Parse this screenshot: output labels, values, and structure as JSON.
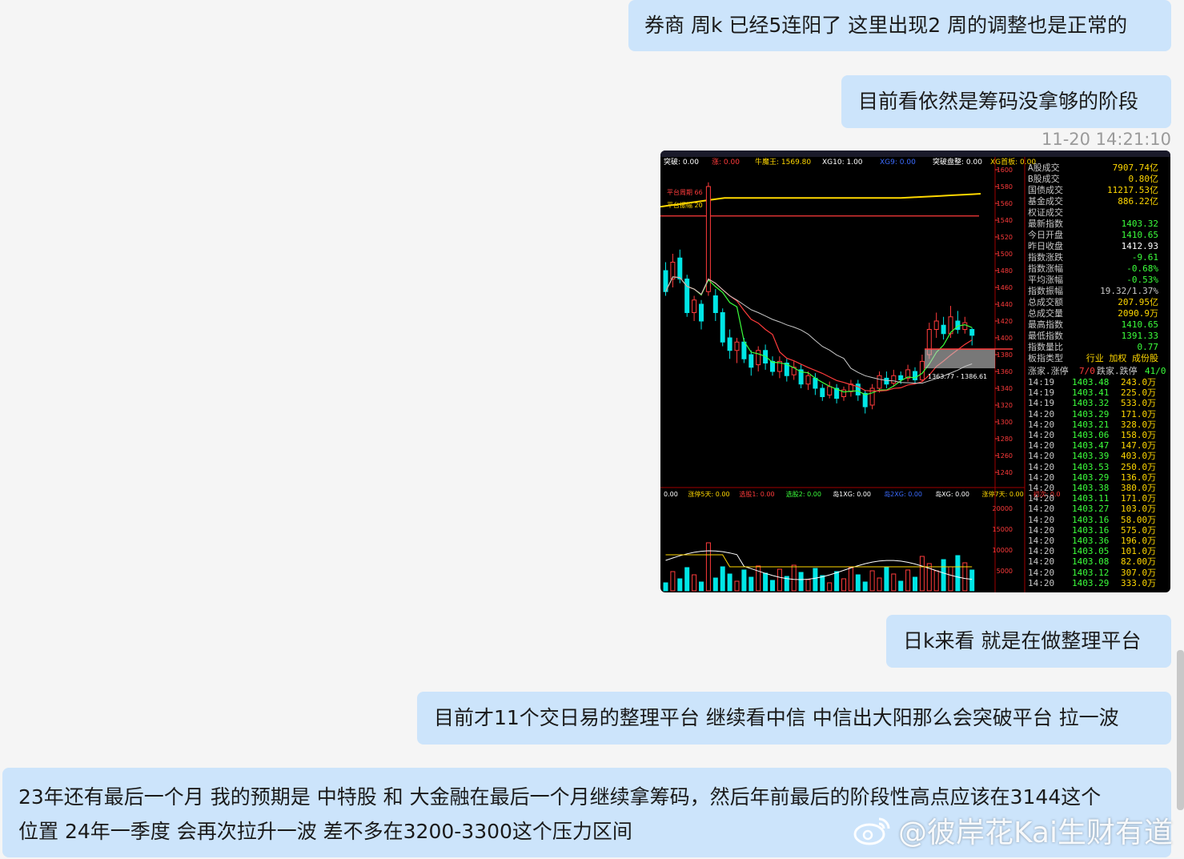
{
  "messages": [
    {
      "text": "券商 周k  已经5连阳了 这里出现2 周的调整也是正常的"
    },
    {
      "text": "目前看依然是筹码没拿够的阶段"
    },
    {
      "timestamp": "11-20 14:21:10"
    },
    {
      "text": "日k来看 就是在做整理平台"
    },
    {
      "text": "目前才11个交日易的整理平台  继续看中信 中信出大阳那么会突破平台 拉一波"
    },
    {
      "text_line1": "23年还有最后一个月 我的预期是 中特股 和 大金融在最后一个月继续拿筹码，然后年前最后的阶段性高点应该在3144这个",
      "text_line2": "位置 24年一季度 会再次拉升一波 差不多在3200-3300这个压力区间"
    }
  ],
  "watermark": "@彼岸花Kai生财有道",
  "screenshot": {
    "top_indicators": [
      {
        "text": "突破: 0.00",
        "color": "#ffffff"
      },
      {
        "text": "涨: 0.00",
        "color": "#ff3b3b"
      },
      {
        "text": "牛魔王: 1569.80",
        "color": "#ffd700"
      },
      {
        "text": "XG10: 1.00",
        "color": "#ffffff"
      },
      {
        "text": "XG9: 0.00",
        "color": "#3b6bff"
      },
      {
        "text": "突破盘整: 0.00",
        "color": "#ffffff"
      },
      {
        "text": "XG首板: 0.00",
        "color": "#ffd700"
      }
    ],
    "platform_labels": [
      "平台周期 66",
      "平台振幅 20"
    ],
    "range_label": "1363.77 - 1386.61",
    "price_axis": [
      "1600",
      "1580",
      "1560",
      "1540",
      "1520",
      "1500",
      "1480",
      "1460",
      "1440",
      "1420",
      "1400",
      "1380",
      "1360",
      "1340",
      "1320",
      "1300",
      "1280",
      "1260",
      "1240"
    ],
    "vol_axis": [
      "20000",
      "15000",
      "10000",
      "5000"
    ],
    "bottom_indicators": [
      {
        "text": "0.00",
        "color": "#ffffff"
      },
      {
        "text": "涨停5天: 0.00",
        "color": "#ffd700"
      },
      {
        "text": "选股1: 0.00",
        "color": "#ff3b3b"
      },
      {
        "text": "选股2: 0.00",
        "color": "#3bff3b"
      },
      {
        "text": "岛1XG: 0.00",
        "color": "#ffffff"
      },
      {
        "text": "岛2XG: 0.00",
        "color": "#3b6bff"
      },
      {
        "text": "岛XG: 0.00",
        "color": "#ffffff"
      },
      {
        "text": "涨停7天: 0.00",
        "color": "#ffd700"
      },
      {
        "text": "初次: 0.0",
        "color": "#ff3b3b"
      }
    ],
    "stats": [
      {
        "label": "A股成交",
        "value": "7907.74亿",
        "color": "#ffd700"
      },
      {
        "label": "B股成交",
        "value": "0.80亿",
        "color": "#ffd700"
      },
      {
        "label": "国债成交",
        "value": "11217.53亿",
        "color": "#ffd700"
      },
      {
        "label": "基金成交",
        "value": "886.22亿",
        "color": "#ffd700"
      },
      {
        "label": "权证成交",
        "value": "",
        "color": "#ffd700"
      },
      {
        "label": "最新指数",
        "value": "1403.32",
        "color": "#3bff3b"
      },
      {
        "label": "今日开盘",
        "value": "1410.65",
        "color": "#3bff3b"
      },
      {
        "label": "昨日收盘",
        "value": "1412.93",
        "color": "#ffffff"
      },
      {
        "label": "指数涨跌",
        "value": "-9.61",
        "color": "#3bff3b"
      },
      {
        "label": "指数涨幅",
        "value": "-0.68%",
        "color": "#3bff3b"
      },
      {
        "label": "平均涨幅",
        "value": "-0.53%",
        "color": "#3bff3b"
      },
      {
        "label": "指数振幅",
        "value": "19.32/1.37%",
        "color": "#c8c8c8"
      },
      {
        "label": "总成交额",
        "value": "207.95亿",
        "color": "#ffd700"
      },
      {
        "label": "总成交量",
        "value": "2090.9万",
        "color": "#ffd700"
      },
      {
        "label": "最高指数",
        "value": "1410.65",
        "color": "#3bff3b"
      },
      {
        "label": "最低指数",
        "value": "1391.33",
        "color": "#3bff3b"
      },
      {
        "label": "指数量比",
        "value": "0.77",
        "color": "#3bff3b"
      }
    ],
    "board_type": {
      "label": "板指类型",
      "value": "行业 加权 成份股"
    },
    "updown": {
      "label": "涨家.涨停",
      "value1": "7/0",
      "label2": "跌家.跌停",
      "value2": "41/0"
    },
    "ticks": [
      {
        "time": "14:19",
        "price": "1403.48",
        "vol": "243.0万"
      },
      {
        "time": "14:19",
        "price": "1403.41",
        "vol": "225.0万"
      },
      {
        "time": "14:19",
        "price": "1403.32",
        "vol": "533.0万"
      },
      {
        "time": "14:20",
        "price": "1403.29",
        "vol": "171.0万"
      },
      {
        "time": "14:20",
        "price": "1403.21",
        "vol": "328.0万"
      },
      {
        "time": "14:20",
        "price": "1403.06",
        "vol": "158.0万"
      },
      {
        "time": "14:20",
        "price": "1403.47",
        "vol": "147.0万"
      },
      {
        "time": "14:20",
        "price": "1403.39",
        "vol": "403.0万"
      },
      {
        "time": "14:20",
        "price": "1403.53",
        "vol": "250.0万"
      },
      {
        "time": "14:20",
        "price": "1403.29",
        "vol": "136.0万"
      },
      {
        "time": "14:20",
        "price": "1403.38",
        "vol": "380.0万"
      },
      {
        "time": "14:20",
        "price": "1403.11",
        "vol": "171.0万"
      },
      {
        "time": "14:20",
        "price": "1403.27",
        "vol": "103.0万"
      },
      {
        "time": "14:20",
        "price": "1403.16",
        "vol": "58.00万"
      },
      {
        "time": "14:20",
        "price": "1403.16",
        "vol": "575.0万"
      },
      {
        "time": "14:20",
        "price": "1403.36",
        "vol": "196.0万"
      },
      {
        "time": "14:20",
        "price": "1403.05",
        "vol": "101.0万"
      },
      {
        "time": "14:20",
        "price": "1403.08",
        "vol": "82.00万"
      },
      {
        "time": "14:20",
        "price": "1403.12",
        "vol": "307.0万"
      },
      {
        "time": "14:20",
        "price": "1403.29",
        "vol": "333.0万"
      }
    ],
    "colors": {
      "up": "#ff3b3b",
      "down": "#00e5e5",
      "ma5": "#ffffff",
      "ma10": "#ffd700",
      "ma20": "#3bff3b"
    }
  }
}
